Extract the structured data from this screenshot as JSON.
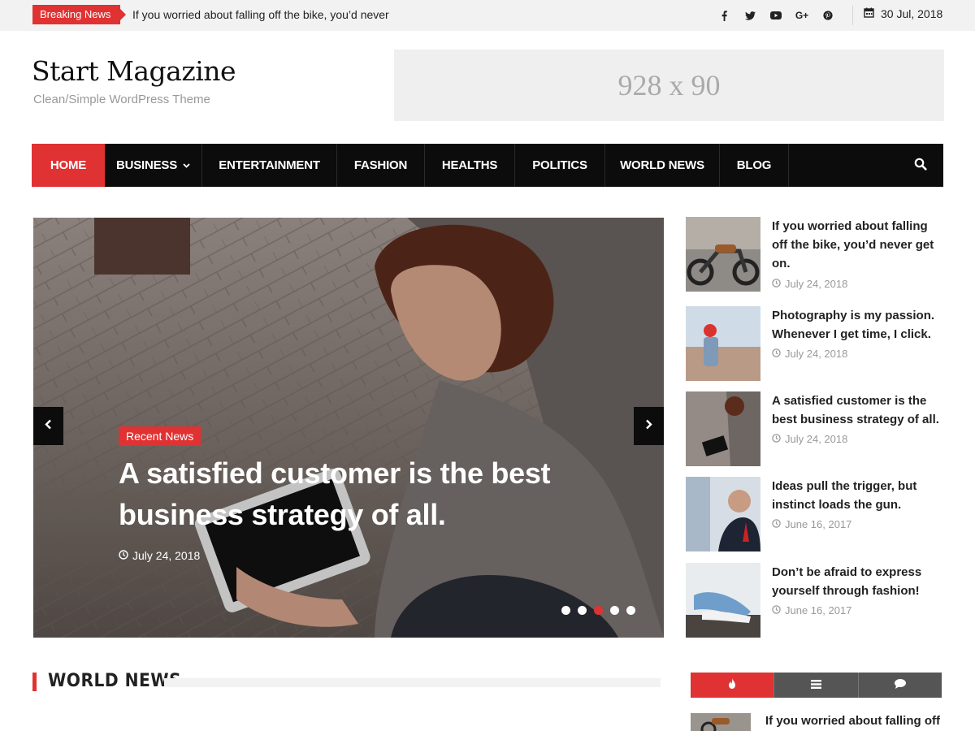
{
  "topbar": {
    "breaking_label": "Breaking News",
    "breaking_text": "If you worried about falling off the bike, you’d never",
    "socials": [
      "facebook-icon",
      "twitter-icon",
      "youtube-icon",
      "google-plus-icon",
      "pinterest-icon"
    ],
    "google_plus_text": "G+",
    "date": "30 Jul, 2018"
  },
  "header": {
    "site_title": "Start Magazine",
    "tagline": "Clean/Simple WordPress Theme",
    "ad_text": "928 x 90"
  },
  "nav": {
    "items": [
      {
        "label": "HOME",
        "active": true
      },
      {
        "label": "BUSINESS",
        "has_dropdown": true
      },
      {
        "label": "ENTERTAINMENT"
      },
      {
        "label": "FASHION"
      },
      {
        "label": "HEALTHS"
      },
      {
        "label": "POLITICS"
      },
      {
        "label": "WORLD NEWS"
      },
      {
        "label": "BLOG"
      }
    ]
  },
  "slider": {
    "category": "Recent News",
    "title": "A satisfied customer is the best business strategy of all.",
    "date": "July 24, 2018",
    "dot_count": 5,
    "active_dot": 3
  },
  "sidebar": {
    "posts": [
      {
        "title": "If you worried about falling off the bike, you’d never get on.",
        "date": "July 24, 2018"
      },
      {
        "title": "Photography is my passion. Whenever I get time, I click.",
        "date": "July 24, 2018"
      },
      {
        "title": "A satisfied customer is the best business strategy of all.",
        "date": "July 24, 2018"
      },
      {
        "title": "Ideas pull the trigger, but instinct loads the gun.",
        "date": "June 16, 2017"
      },
      {
        "title": "Don’t be afraid to express yourself through fashion!",
        "date": "June 16, 2017"
      }
    ]
  },
  "world_news": {
    "heading": "WORLD NEWS"
  },
  "tabs_widget": {
    "tabs": [
      "fire-icon",
      "list-icon",
      "comment-icon"
    ],
    "first_item_title": "If you worried about falling off"
  },
  "colors": {
    "accent": "#e03232",
    "nav_bg": "#0c0c0c",
    "topbar_bg": "#f2f2f2"
  }
}
